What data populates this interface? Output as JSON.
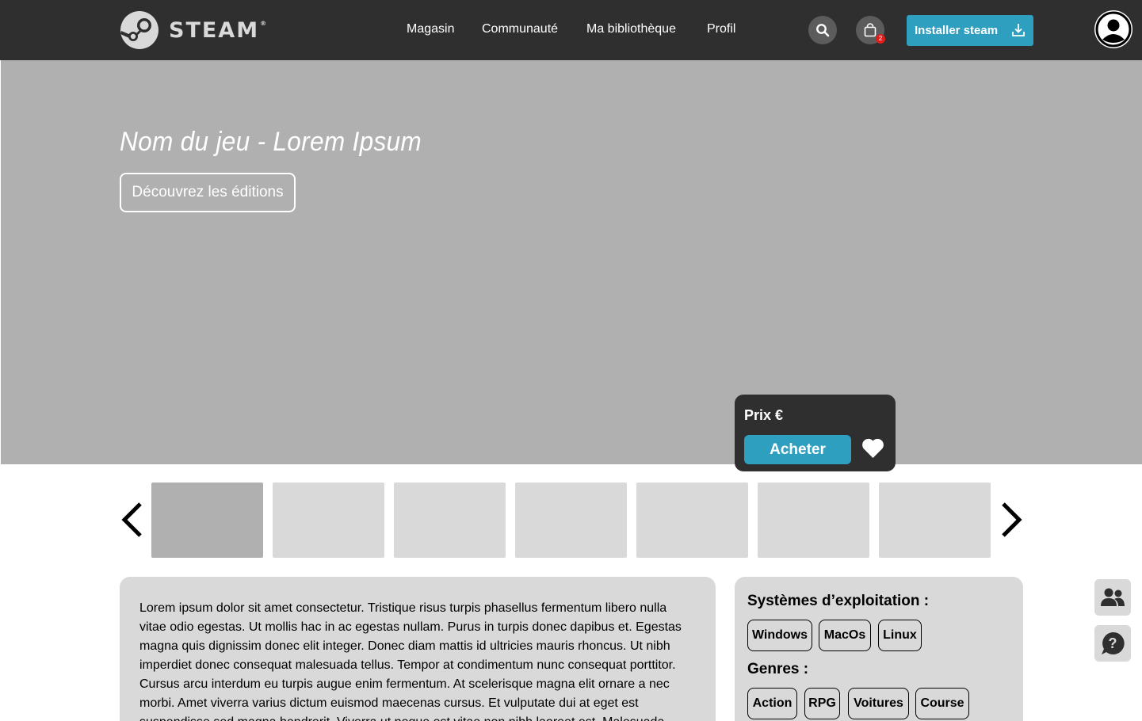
{
  "header": {
    "logo_text": "STEAM",
    "logo_reg": "®",
    "nav": [
      "Magasin",
      "Communauté",
      "Ma bibliothèque",
      "Profil"
    ],
    "cart_count": "2",
    "install_label": "Installer steam"
  },
  "hero": {
    "title": "Nom du jeu - Lorem Ipsum",
    "editions_label": "Découvrez les éditions"
  },
  "purchase": {
    "price_label": "Prix €",
    "buy_label": "Acheter"
  },
  "description": {
    "text": "Lorem ipsum dolor sit amet consectetur. Tristique risus turpis phasellus fermentum libero nulla vitae odio egestas. Ut mollis hac in ac egestas nullam. Purus in turpis donec dapibus et. Egestas magna quis dignissim donec elit integer. Donec diam mattis id ultricies mauris rhoncus. Ut nibh imperdiet donec consequat malesuada tellus. Tempor at condimentum nunc consequat porttitor. Cursus arcu interdum eu turpis augue enim fermentum. At scelerisque magna elit ornare a nec morbi. Amet viverra varius dictum euismod maecenas cursus. Et vulputate dui at eget est suspendisse sed magna hendrerit. Viverra ut neque est vitae non nibh laoreet est. Malesuada"
  },
  "info": {
    "os_heading": "Systèmes d’exploitation :",
    "os": [
      "Windows",
      "MacOs",
      "Linux"
    ],
    "genres_heading": "Genres :",
    "genres": [
      "Action",
      "RPG",
      "Voitures",
      "Course"
    ]
  },
  "colors": {
    "header_bg": "#2f2f2f",
    "accent": "#2f9fbf",
    "hero_bg": "#b0b0b0",
    "panel_bg": "#d9d9d9",
    "badge": "#e11d1d"
  },
  "icons": [
    "steam-logo-icon",
    "search-icon",
    "cart-icon",
    "download-icon",
    "user-icon",
    "heart-icon",
    "chevron-left-icon",
    "chevron-right-icon",
    "friends-icon",
    "help-icon"
  ]
}
